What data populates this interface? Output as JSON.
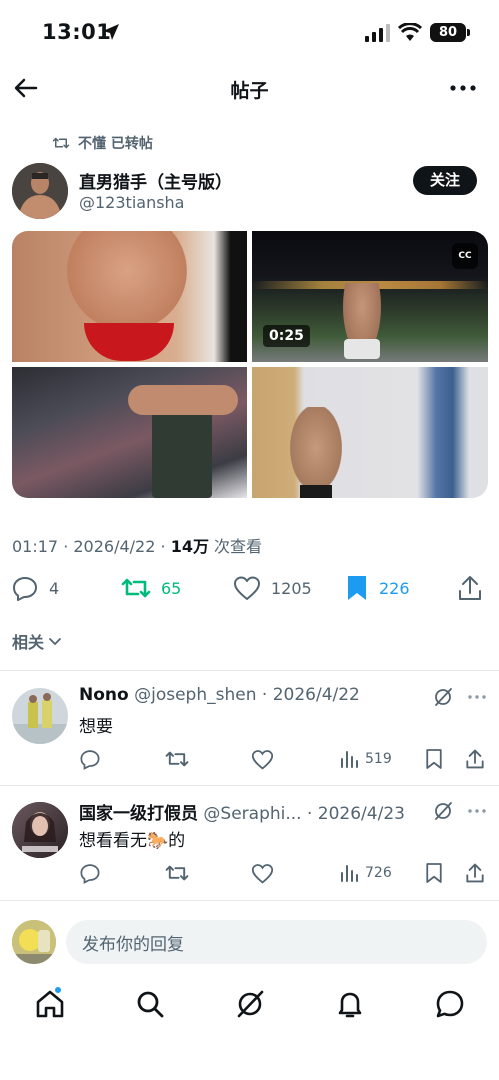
{
  "status_bar": {
    "time": "13:01",
    "battery": "80"
  },
  "header": {
    "title": "帖子"
  },
  "retweet_note": "不懂 已转帖",
  "author": {
    "name": "直男猎手（主号版）",
    "handle": "@123tiansha",
    "follow_label": "关注"
  },
  "media": {
    "cc_label": "CC",
    "video_duration": "0:25"
  },
  "meta": {
    "time": "01:17",
    "separator": " · ",
    "date": "2026/4/22",
    "views": "14万",
    "views_suffix": " 次查看"
  },
  "stats": {
    "replies": "4",
    "retweets": "65",
    "likes": "1205",
    "bookmarks": "226"
  },
  "related_label": "相关",
  "replies": [
    {
      "name": "Nono",
      "handle": "@joseph_shen",
      "date": "· 2026/4/22",
      "text": "想要",
      "views": "519"
    },
    {
      "name": "国家一级打假员",
      "handle": "@Seraphi...",
      "date": "· 2026/4/23",
      "text": "想看看无🐎的",
      "views": "726"
    }
  ],
  "compose": {
    "placeholder": "发布你的回复"
  },
  "colors": {
    "accent": "#1d9bf0",
    "retweet": "#00ba7c",
    "text": "#0f1419",
    "secondary": "#536471"
  }
}
